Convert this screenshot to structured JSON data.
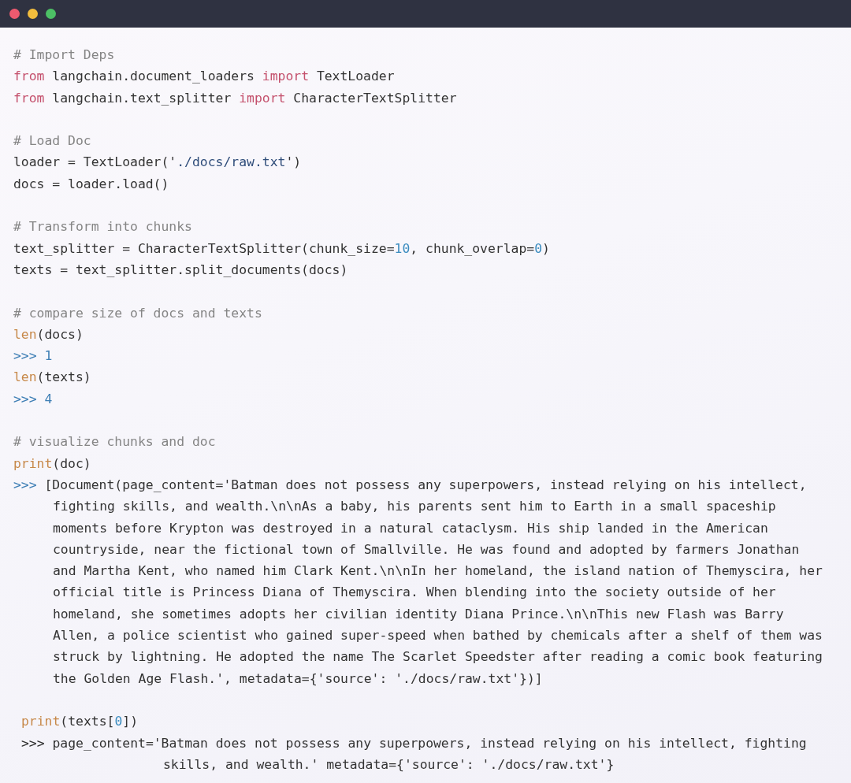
{
  "window": {
    "controls": [
      {
        "kind": "close"
      },
      {
        "kind": "minimize"
      },
      {
        "kind": "zoom"
      }
    ]
  },
  "lines": [
    {
      "kind": "line",
      "tokens": [
        {
          "kind": "comment",
          "text": "# Import Deps"
        }
      ]
    },
    {
      "kind": "line",
      "tokens": [
        {
          "kind": "keyword",
          "text": "from"
        },
        {
          "kind": "plain",
          "text": " langchain.document_loaders "
        },
        {
          "kind": "keyword",
          "text": "import"
        },
        {
          "kind": "plain",
          "text": " TextLoader"
        }
      ]
    },
    {
      "kind": "line",
      "tokens": [
        {
          "kind": "keyword",
          "text": "from"
        },
        {
          "kind": "plain",
          "text": " langchain.text_splitter "
        },
        {
          "kind": "keyword",
          "text": "import"
        },
        {
          "kind": "plain",
          "text": " CharacterTextSplitter"
        }
      ]
    },
    {
      "kind": "blank"
    },
    {
      "kind": "line",
      "tokens": [
        {
          "kind": "comment",
          "text": "# Load Doc"
        }
      ]
    },
    {
      "kind": "line",
      "tokens": [
        {
          "kind": "plain",
          "text": "loader = TextLoader('"
        },
        {
          "kind": "string",
          "text": "./docs/raw.txt"
        },
        {
          "kind": "plain",
          "text": "')"
        }
      ]
    },
    {
      "kind": "line",
      "tokens": [
        {
          "kind": "plain",
          "text": "docs = loader.load()"
        }
      ]
    },
    {
      "kind": "blank"
    },
    {
      "kind": "line",
      "tokens": [
        {
          "kind": "comment",
          "text": "# Transform into chunks"
        }
      ]
    },
    {
      "kind": "line",
      "tokens": [
        {
          "kind": "plain",
          "text": "text_splitter = CharacterTextSplitter(chunk_size="
        },
        {
          "kind": "number",
          "text": "10"
        },
        {
          "kind": "plain",
          "text": ", chunk_overlap="
        },
        {
          "kind": "number",
          "text": "0"
        },
        {
          "kind": "plain",
          "text": ")"
        }
      ]
    },
    {
      "kind": "line",
      "tokens": [
        {
          "kind": "plain",
          "text": "texts = text_splitter.split_documents(docs)"
        }
      ]
    },
    {
      "kind": "blank"
    },
    {
      "kind": "line",
      "tokens": [
        {
          "kind": "comment",
          "text": "# compare size of docs and texts"
        }
      ]
    },
    {
      "kind": "line",
      "tokens": [
        {
          "kind": "builtin",
          "text": "len"
        },
        {
          "kind": "plain",
          "text": "(docs)"
        }
      ]
    },
    {
      "kind": "line",
      "tokens": [
        {
          "kind": "prompt",
          "text": ">>> 1"
        }
      ]
    },
    {
      "kind": "line",
      "tokens": [
        {
          "kind": "builtin",
          "text": "len"
        },
        {
          "kind": "plain",
          "text": "(texts)"
        }
      ]
    },
    {
      "kind": "line",
      "tokens": [
        {
          "kind": "prompt",
          "text": ">>> 4"
        }
      ]
    },
    {
      "kind": "blank"
    },
    {
      "kind": "line",
      "tokens": [
        {
          "kind": "comment",
          "text": "# visualize chunks and doc"
        }
      ]
    },
    {
      "kind": "line",
      "tokens": [
        {
          "kind": "builtin",
          "text": "print"
        },
        {
          "kind": "plain",
          "text": "(doc)"
        }
      ]
    },
    {
      "kind": "line",
      "tokens": [
        {
          "kind": "prompt",
          "text": ">>>"
        },
        {
          "kind": "plain",
          "text": " [Document(page_content='Batman does not possess any superpowers, instead relying on his intellect,"
        }
      ]
    },
    {
      "kind": "wrap",
      "tokens": [
        {
          "kind": "plain",
          "text": "fighting skills, and wealth.\\n\\nAs a baby, his parents sent him to Earth in a small spaceship"
        }
      ]
    },
    {
      "kind": "wrap",
      "tokens": [
        {
          "kind": "plain",
          "text": "moments before Krypton was destroyed in a natural cataclysm. His ship landed in the American"
        }
      ]
    },
    {
      "kind": "wrap",
      "tokens": [
        {
          "kind": "plain",
          "text": "countryside, near the fictional town of Smallville. He was found and adopted by farmers Jonathan"
        }
      ]
    },
    {
      "kind": "wrap",
      "tokens": [
        {
          "kind": "plain",
          "text": "and Martha Kent, who named him Clark Kent.\\n\\nIn her homeland, the island nation of Themyscira, her"
        }
      ]
    },
    {
      "kind": "wrap",
      "tokens": [
        {
          "kind": "plain",
          "text": "official title is Princess Diana of Themyscira. When blending into the society outside of her"
        }
      ]
    },
    {
      "kind": "wrap",
      "tokens": [
        {
          "kind": "plain",
          "text": "homeland, she sometimes adopts her civilian identity Diana Prince.\\n\\nThis new Flash was Barry"
        }
      ]
    },
    {
      "kind": "wrap",
      "tokens": [
        {
          "kind": "plain",
          "text": "Allen, a police scientist who gained super-speed when bathed by chemicals after a shelf of them was"
        }
      ]
    },
    {
      "kind": "wrap",
      "tokens": [
        {
          "kind": "plain",
          "text": "struck by lightning. He adopted the name The Scarlet Speedster after reading a comic book featuring"
        }
      ]
    },
    {
      "kind": "wrap",
      "tokens": [
        {
          "kind": "plain",
          "text": "the Golden Age Flash.', metadata={'source': './docs/raw.txt'})]"
        }
      ]
    },
    {
      "kind": "blank"
    },
    {
      "kind": "inset",
      "tokens": [
        {
          "kind": "builtin",
          "text": "print"
        },
        {
          "kind": "plain",
          "text": "(texts["
        },
        {
          "kind": "number",
          "text": "0"
        },
        {
          "kind": "plain",
          "text": "])"
        }
      ]
    },
    {
      "kind": "inset",
      "tokens": [
        {
          "kind": "plain",
          "text": ">>> page_content='Batman does not possess any superpowers, instead relying on his intellect, fighting"
        }
      ]
    },
    {
      "kind": "inset_wrap",
      "tokens": [
        {
          "kind": "plain",
          "text": "skills, and wealth.' metadata={'source': './docs/raw.txt'}"
        }
      ]
    }
  ]
}
